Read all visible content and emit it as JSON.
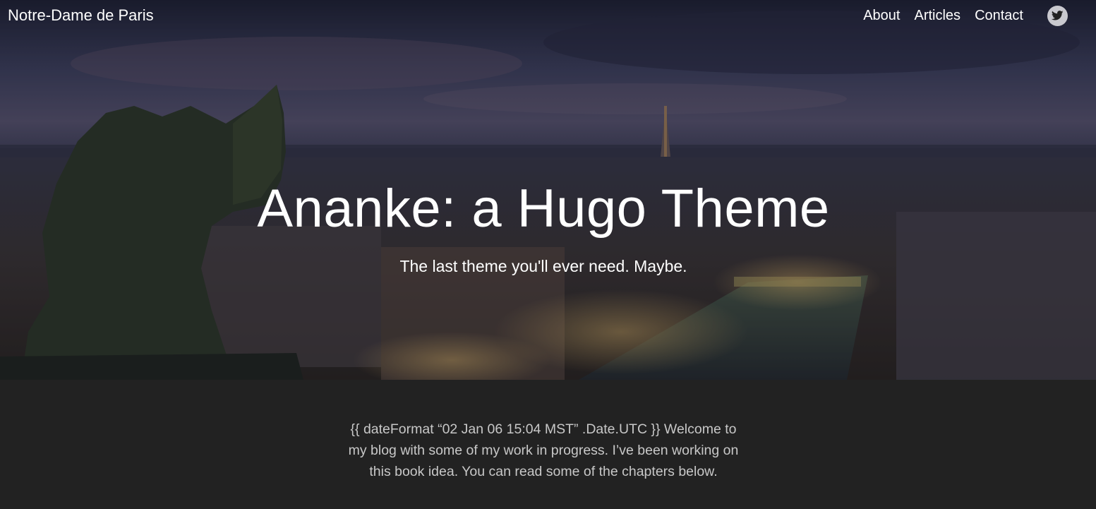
{
  "header": {
    "site_title": "Notre-Dame de Paris",
    "nav": [
      {
        "label": "About"
      },
      {
        "label": "Articles"
      },
      {
        "label": "Contact"
      }
    ],
    "social_icon": "twitter-icon"
  },
  "hero": {
    "heading": "Ananke: a Hugo Theme",
    "subtitle": "The last theme you'll ever need. Maybe."
  },
  "main": {
    "intro": "{{ dateFormat “02 Jan 06 15:04 MST” .Date.UTC }} Welcome to my blog with some of my work in progress. I’ve been working on this book idea. You can read some of the chapters below."
  },
  "colors": {
    "page_background": "#222222",
    "nav_text": "#ffffff",
    "body_text": "#c8c8c8"
  }
}
